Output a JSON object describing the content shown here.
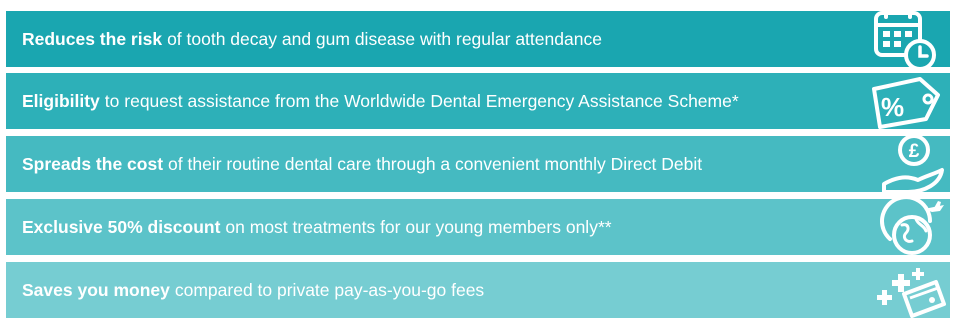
{
  "benefits": [
    {
      "bold": "Reduces the risk",
      "text": "of tooth decay and gum disease with regular attendance",
      "icon": "calendar-clock-icon"
    },
    {
      "bold": "Eligibility",
      "text": "to request assistance from the Worldwide Dental Emergency Assistance Scheme*",
      "icon": "percent-tag-icon"
    },
    {
      "bold": "Spreads the cost",
      "text": "of their routine dental care through a convenient monthly Direct Debit",
      "icon": "hand-pound-coin-icon"
    },
    {
      "bold": "Exclusive 50% discount",
      "text": "on most treatments for our young members only**",
      "icon": "globe-plane-icon"
    },
    {
      "bold": "Saves you money",
      "text": "compared to private pay-as-you-go fees",
      "icon": "wallet-plus-icon"
    }
  ],
  "icon_glyphs": {
    "percent": "%",
    "pound": "£"
  },
  "colors": {
    "banner_1": "#1aa6b0",
    "banner_2": "#2db0b8",
    "banner_3": "#45bac1",
    "banner_4": "#5cc3c9",
    "banner_5": "#76cdd2",
    "text": "#ffffff"
  }
}
